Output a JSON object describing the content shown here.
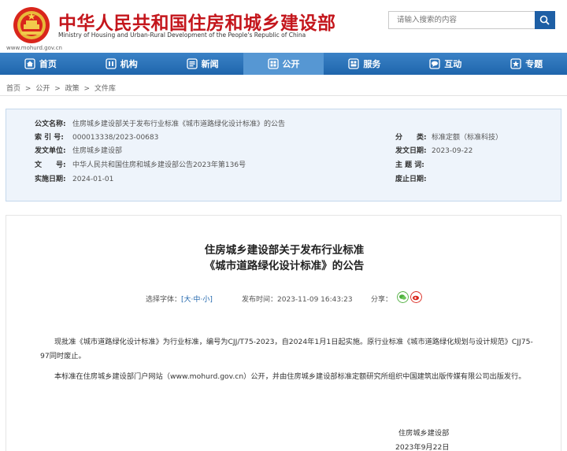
{
  "header": {
    "title": "中华人民共和国住房和城乡建设部",
    "subtitle": "Ministry of Housing and Urban-Rural Development of the People's Republic of China",
    "url": "www.mohurd.gov.cn",
    "search_placeholder": "请输入搜索的内容",
    "emblem_icon": "national-emblem-icon",
    "accent_color": "#c4161c",
    "nav_color": "#1f65ac"
  },
  "nav": {
    "items": [
      {
        "label": "首页",
        "icon": "home-icon"
      },
      {
        "label": "机构",
        "icon": "organization-icon"
      },
      {
        "label": "新闻",
        "icon": "news-icon"
      },
      {
        "label": "公开",
        "icon": "disclosure-icon"
      },
      {
        "label": "服务",
        "icon": "service-icon"
      },
      {
        "label": "互动",
        "icon": "interaction-icon"
      },
      {
        "label": "专题",
        "icon": "topic-icon"
      }
    ],
    "active": "公开"
  },
  "breadcrumb": [
    "首页",
    ">",
    "公开",
    ">",
    "政策",
    ">",
    "文件库"
  ],
  "info": {
    "title_label": "公文名称:",
    "title_value": "住房城乡建设部关于发布行业标准《城市道路绿化设计标准》的公告",
    "index_label": "索 引 号:",
    "index_value": "000013338/2023-00683",
    "issuer_label": "发文单位:",
    "issuer_value": "住房城乡建设部",
    "docno_label": "文　　号:",
    "docno_value": "中华人民共和国住房和城乡建设部公告2023年第136号",
    "effective_label": "实施日期:",
    "effective_value": "2024-01-01",
    "category_label": "分　　类:",
    "category_value": "标准定额（标准科技）",
    "date_label": "发文日期:",
    "date_value": "2023-09-22",
    "subject_label": "主 题 词:",
    "subject_value": "",
    "repeal_label": "废止日期:",
    "repeal_value": ""
  },
  "article": {
    "title_line1": "住房城乡建设部关于发布行业标准",
    "title_line2": "《城市道路绿化设计标准》的公告",
    "font_label": "选择字体：",
    "font_bracket_open": "[",
    "font_large": "大",
    "font_sep1": "·",
    "font_medium": "中",
    "font_sep2": "·",
    "font_small": "小",
    "font_bracket_close": "]",
    "publish_label": "发布时间：",
    "publish_time": "2023-11-09 16:43:23",
    "share_label": "分享：",
    "share_icons": [
      "wechat-icon",
      "weibo-icon"
    ],
    "paragraph1": "现批准《城市道路绿化设计标准》为行业标准，编号为CJJ/T75-2023，自2024年1月1日起实施。原行业标准《城市道路绿化规划与设计规范》CJJ75-97同时废止。",
    "paragraph2": "本标准在住房城乡建设部门户网站（www.mohurd.gov.cn）公开，并由住房城乡建设部标准定额研究所组织中国建筑出版传媒有限公司出版发行。",
    "signature": "住房城乡建设部",
    "sign_date": "2023年9月22日"
  }
}
